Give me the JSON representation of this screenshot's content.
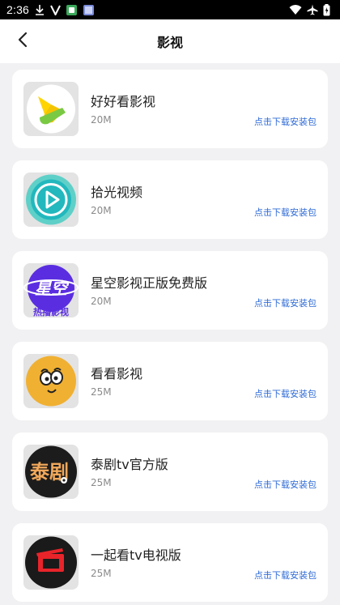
{
  "status_bar": {
    "time": "2:36",
    "left_icons": [
      "download-icon",
      "v-icon",
      "photo-icon",
      "gallery-icon"
    ],
    "right_icons": [
      "wifi-icon",
      "airplane-icon",
      "battery-icon"
    ]
  },
  "header": {
    "title": "影视",
    "back_icon": "chevron-left-icon"
  },
  "apps": [
    {
      "name": "好好看影视",
      "size": "20M",
      "action": "点击下载安装包",
      "icon": "haohaokan-logo-icon"
    },
    {
      "name": "拾光视频",
      "size": "20M",
      "action": "点击下载安装包",
      "icon": "shiguang-play-icon"
    },
    {
      "name": "星空影视正版免费版",
      "size": "20M",
      "action": "点击下载安装包",
      "icon": "xingkong-logo-icon",
      "icon_text_main": "星空",
      "icon_text_sub": "热播影视"
    },
    {
      "name": "看看影视",
      "size": "25M",
      "action": "点击下载安装包",
      "icon": "kankan-face-icon"
    },
    {
      "name": "泰剧tv官方版",
      "size": "25M",
      "action": "点击下载安装包",
      "icon": "taiju-logo-icon",
      "icon_text_main": "泰剧"
    },
    {
      "name": "一起看tv电视版",
      "size": "25M",
      "action": "点击下载安装包",
      "icon": "yiqikan-tv-icon"
    }
  ],
  "colors": {
    "background": "#f1f1f3",
    "card": "#ffffff",
    "link": "#2f6bd6"
  }
}
